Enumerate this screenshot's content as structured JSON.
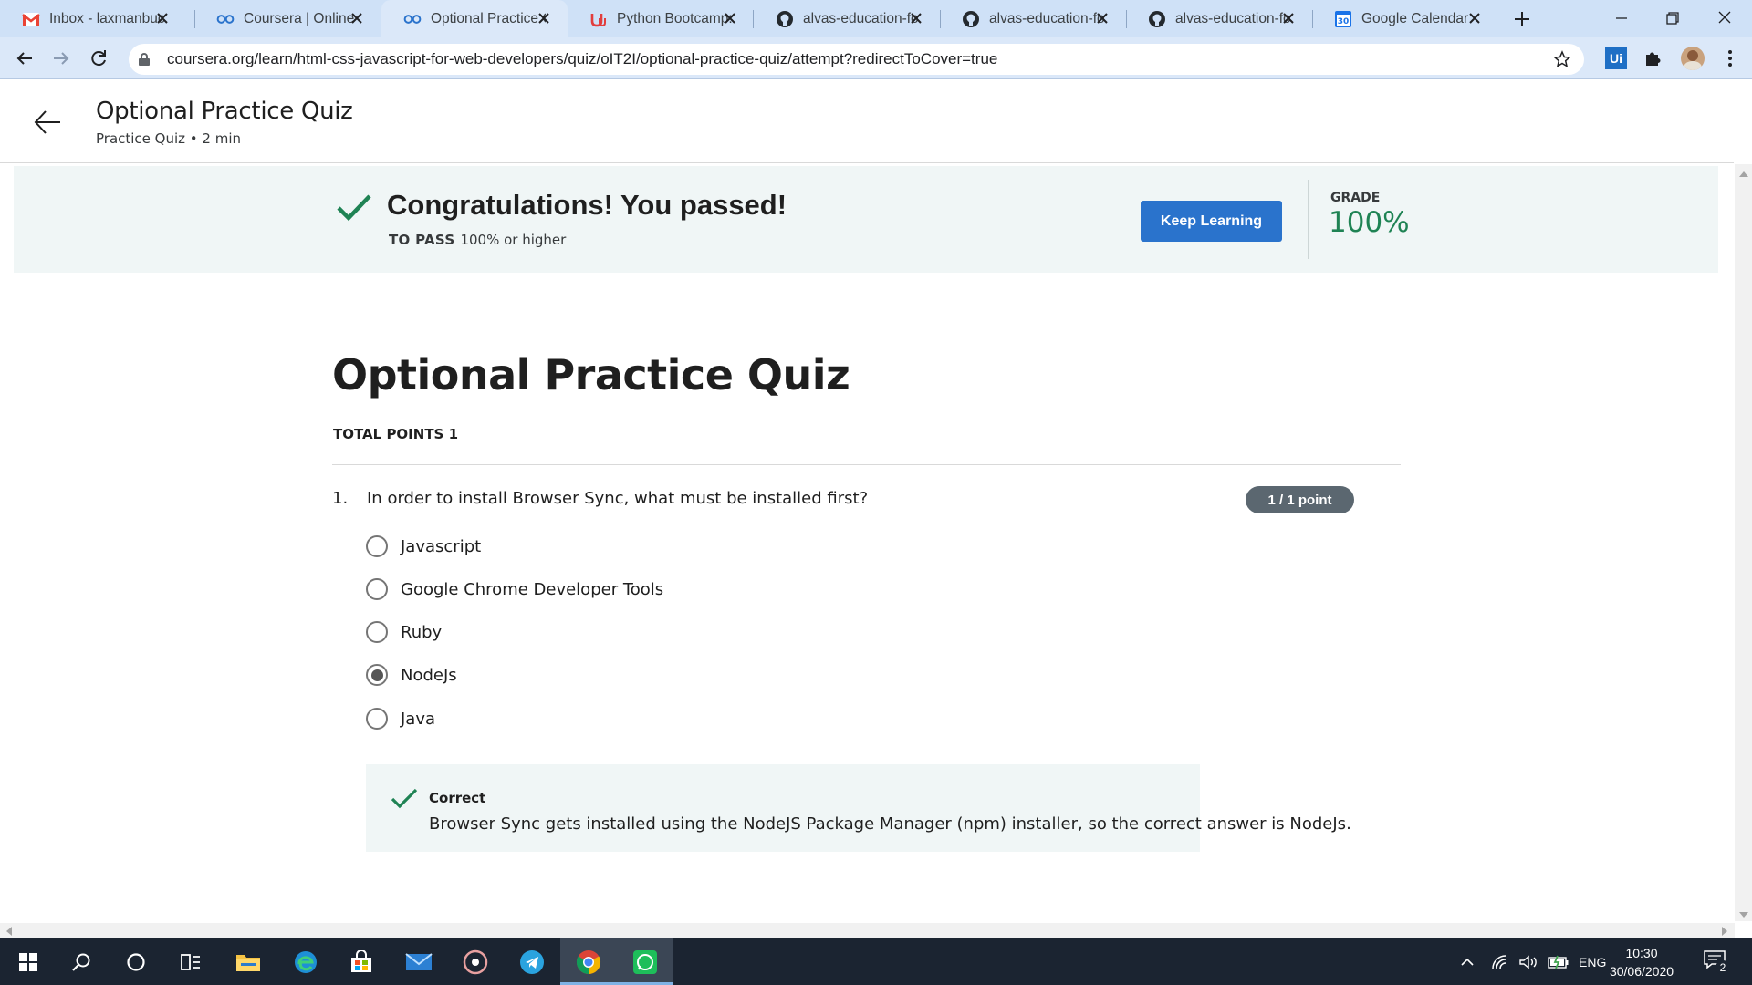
{
  "browser": {
    "tabs": [
      {
        "title": "Inbox - laxmanbuc",
        "icon": "gmail-icon",
        "active": false
      },
      {
        "title": "Coursera | Online C",
        "icon": "coursera-icon",
        "active": false
      },
      {
        "title": "Optional Practice C",
        "icon": "coursera-icon",
        "active": true
      },
      {
        "title": "Python Bootcamp:",
        "icon": "udemy-icon",
        "active": false
      },
      {
        "title": "alvas-education-fo",
        "icon": "github-icon",
        "active": false
      },
      {
        "title": "alvas-education-fo",
        "icon": "github-icon",
        "active": false
      },
      {
        "title": "alvas-education-fo",
        "icon": "github-icon",
        "active": false
      },
      {
        "title": "Google Calendar -",
        "icon": "google-calendar-icon",
        "calendar_day": "30",
        "active": false
      }
    ],
    "url": "coursera.org/learn/html-css-javascript-for-web-developers/quiz/oIT2I/optional-practice-quiz/attempt?redirectToCover=true",
    "extension_label": "Ui"
  },
  "header": {
    "title": "Optional Practice Quiz",
    "subtitle": "Practice Quiz • 2 min"
  },
  "result": {
    "headline": "Congratulations! You passed!",
    "to_pass_label": "TO PASS",
    "to_pass_value": "100% or higher",
    "keep_learning_label": "Keep Learning",
    "grade_label": "GRADE",
    "grade_value": "100%",
    "accent_color": "#1f8354",
    "button_color": "#2a73cc"
  },
  "quiz": {
    "title": "Optional Practice Quiz",
    "total_points": "TOTAL POINTS 1",
    "questions": [
      {
        "number": "1.",
        "text": "In order to install Browser Sync, what must be installed first?",
        "score_badge": "1 / 1 point",
        "options": [
          {
            "label": "Javascript",
            "selected": false
          },
          {
            "label": "Google Chrome Developer Tools",
            "selected": false
          },
          {
            "label": "Ruby",
            "selected": false
          },
          {
            "label": "NodeJs",
            "selected": true
          },
          {
            "label": "Java",
            "selected": false
          }
        ],
        "feedback": {
          "status": "Correct",
          "text": "Browser Sync gets installed using the NodeJS Package Manager (npm) installer, so the correct answer is NodeJs."
        }
      }
    ]
  },
  "taskbar": {
    "apps": [
      "windows-start-icon",
      "search-icon",
      "cortana-icon",
      "task-view-icon",
      "file-explorer-icon",
      "edge-icon",
      "store-icon",
      "mail-icon",
      "groove-music-icon",
      "telegram-icon",
      "chrome-icon",
      "whatsapp-icon"
    ],
    "language": "ENG",
    "time": "10:30",
    "date": "30/06/2020",
    "notifications_count": "2"
  }
}
